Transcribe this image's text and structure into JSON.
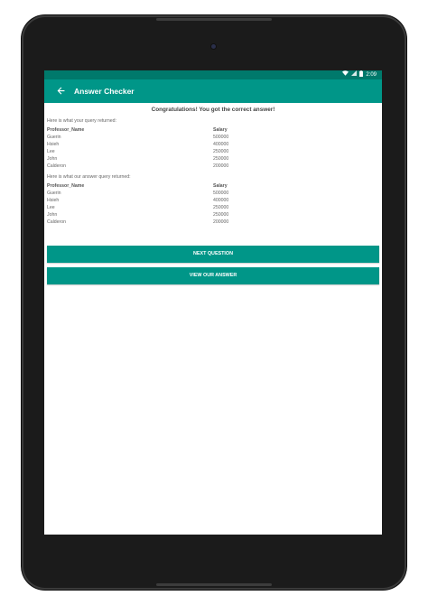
{
  "status_bar": {
    "time": "2:09"
  },
  "app_bar": {
    "title": "Answer Checker"
  },
  "result": {
    "message": "Congratulations! You got the correct answer!",
    "user_query_caption": "Here is what your query returned:",
    "answer_query_caption": "Here is what our answer query returned:"
  },
  "user_result": {
    "columns": [
      "Professor_Name",
      "Salary"
    ],
    "rows": [
      [
        "Guerin",
        "500000"
      ],
      [
        "Hsieh",
        "400000"
      ],
      [
        "Lee",
        "250000"
      ],
      [
        "John",
        "250000"
      ],
      [
        "Calderon",
        "200000"
      ]
    ]
  },
  "answer_result": {
    "columns": [
      "Professor_Name",
      "Salary"
    ],
    "rows": [
      [
        "Guerin",
        "500000"
      ],
      [
        "Hsieh",
        "400000"
      ],
      [
        "Lee",
        "250000"
      ],
      [
        "John",
        "250000"
      ],
      [
        "Calderon",
        "200000"
      ]
    ]
  },
  "buttons": {
    "next_question": "NEXT QUESTION",
    "view_answer": "VIEW OUR ANSWER"
  },
  "colors": {
    "status_bar": "#00796b",
    "app_bar": "#009688",
    "button": "#009688"
  },
  "icons": {
    "back": "arrow-left-icon",
    "wifi": "wifi-icon",
    "signal": "signal-icon",
    "battery": "battery-icon"
  }
}
